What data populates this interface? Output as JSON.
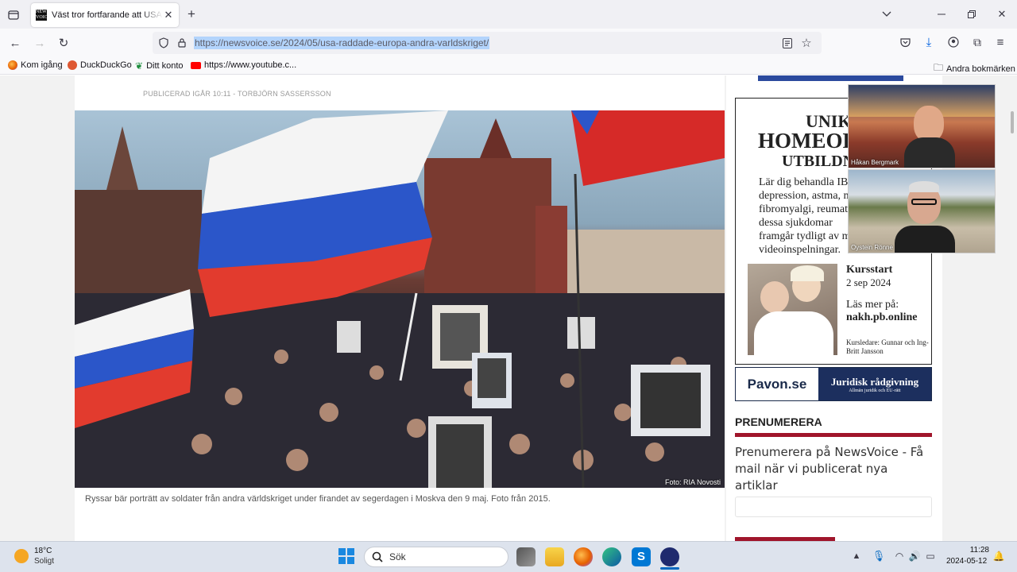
{
  "browser": {
    "tab_title": "Väst tror fortfarande att USA rä",
    "favicon_text": "NEWS VOICE",
    "new_tab": "+",
    "url": "https://newsvoice.se/2024/05/usa-raddade-europa-andra-varldskriget/",
    "bookmarks": [
      "Kom igång",
      "DuckDuckGo",
      "Ditt konto",
      "https://www.youtube.c..."
    ],
    "other_bookmarks": "Andra bokmärken"
  },
  "article": {
    "byline": "PUBLICERAD IGÅR 10:11  - TORBJÖRN SASSERSSON",
    "photo_credit": "Foto: RIA Novosti",
    "caption": "Ryssar bär porträtt av soldater från andra världskriget under firandet av segerdagen i Moskva den 9 maj. Foto från 2015."
  },
  "sidebar": {
    "ad1": {
      "heading1": "UNIK",
      "heading2": "HOMEOP",
      "heading3": "UTBILDN",
      "body": "Lär dig behandla IBS depression, astma, m fibromyalgi, reumat Att dessa sjukdomar framgår tydligt av m videoinspelningar.",
      "course_label": "Kursstart",
      "course_date": "2 sep 2024",
      "read_more": "Läs mer på:",
      "site": "nakh.pb.online",
      "leaders": "Kursledare: Gunnar och Ing-Britt Jansson"
    },
    "ad2": {
      "brand": "Pavon.se",
      "title": "Juridisk rådgivning",
      "sub": "Allmän juridik och EU-rätt"
    },
    "subscribe_heading": "PRENUMERERA",
    "subscribe_text": "Prenumerera på NewsVoice - Få mail när vi publicerat nya artiklar"
  },
  "video": {
    "person1": "Håkan Bergmark",
    "person2": "Oystein Rönne"
  },
  "taskbar": {
    "weather_temp": "18°C",
    "weather_desc": "Soligt",
    "search_placeholder": "Sök",
    "time": "11:28",
    "date": "2024-05-12"
  },
  "colors": {
    "accent_red": "#a0152b",
    "accent_blue": "#2b4a9e"
  }
}
